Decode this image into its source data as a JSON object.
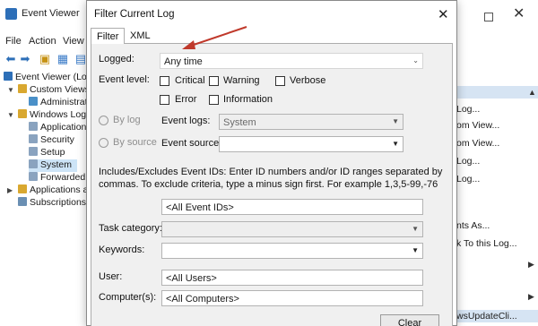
{
  "event_viewer": {
    "title": "Event Viewer",
    "menu": [
      "File",
      "Action",
      "View"
    ],
    "tree": [
      {
        "label": "Event Viewer (Local)"
      },
      {
        "label": "Custom Views"
      },
      {
        "label": "Administrati"
      },
      {
        "label": "Windows Logs"
      },
      {
        "label": "Application"
      },
      {
        "label": "Security"
      },
      {
        "label": "Setup"
      },
      {
        "label": "System"
      },
      {
        "label": "Forwarded E"
      },
      {
        "label": "Applications and"
      },
      {
        "label": "Subscriptions"
      }
    ],
    "actions": [
      {
        "label": "Log..."
      },
      {
        "label": "om View..."
      },
      {
        "label": "om View..."
      },
      {
        "label": "Log..."
      },
      {
        "label": "Log..."
      },
      {
        "label": "nts As..."
      },
      {
        "label": "k To this Log..."
      }
    ],
    "actions_bottom": "wsUpdateCli..."
  },
  "dialog": {
    "title": "Filter Current Log",
    "tabs": {
      "filter": "Filter",
      "xml": "XML"
    },
    "logged": {
      "label": "Logged:",
      "value": "Any time"
    },
    "event_level": {
      "label": "Event level:",
      "critical": "Critical",
      "warning": "Warning",
      "verbose": "Verbose",
      "error": "Error",
      "information": "Information"
    },
    "by_log": "By log",
    "by_source": "By source",
    "event_logs": {
      "label": "Event logs:",
      "value": "System"
    },
    "event_sources": {
      "label": "Event sources:",
      "value": ""
    },
    "description": "Includes/Excludes Event IDs: Enter ID numbers and/or ID ranges separated by commas. To exclude criteria, type a minus sign first. For example 1,3,5-99,-76",
    "event_ids": {
      "value": "<All Event IDs>"
    },
    "task_category": {
      "label": "Task category:",
      "value": ""
    },
    "keywords": {
      "label": "Keywords:",
      "value": ""
    },
    "user": {
      "label": "User:",
      "value": "<All Users>"
    },
    "computer": {
      "label": "Computer(s):",
      "value": "<All Computers>"
    },
    "clear_button": "Clear"
  },
  "colors": {
    "annotation_arrow": "#c0392b",
    "accent": "#2d6fb8"
  }
}
